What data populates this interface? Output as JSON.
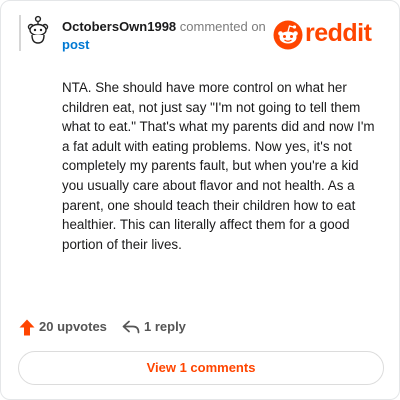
{
  "header": {
    "username": "OctobersOwn1998",
    "action_text": "commented on",
    "post_link": "post"
  },
  "brand": {
    "name": "reddit",
    "color": "#ff4500",
    "icon": "reddit-snoo-icon"
  },
  "comment": {
    "text": "NTA. She should have more control on what her children eat, not just say \"I'm not going to tell them what to eat.\" That's what my parents did and now I'm a fat adult with eating problems. Now yes, it's not completely my parents fault, but when you're a kid you usually care about flavor and not health. As a parent, one should teach their children how to eat healthier. This can literally affect them for a good portion of their lives."
  },
  "actions": {
    "upvotes_label": "20 upvotes",
    "upvote_icon": "upvote-arrow-icon",
    "upvote_color": "#ff4500",
    "reply_label": "1 reply",
    "reply_icon": "reply-arrow-icon"
  },
  "footer": {
    "view_comments_label": "View 1 comments"
  },
  "colors": {
    "link": "#0079d3",
    "muted": "#7c7c7c",
    "text": "#1a1a1b"
  }
}
